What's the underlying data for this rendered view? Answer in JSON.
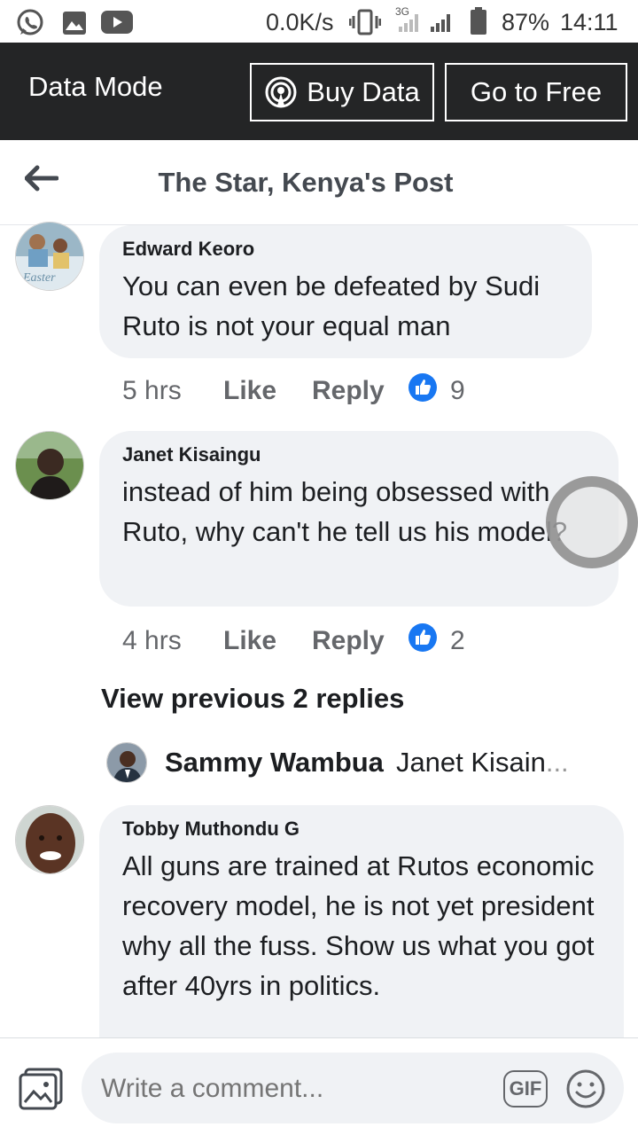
{
  "status_bar": {
    "net_speed": "0.0K/s",
    "network_type": "3G",
    "battery": "87%",
    "time": "14:11",
    "icons": [
      "whatsapp-icon",
      "gallery-icon",
      "youtube-icon",
      "vibrate-icon",
      "signal-icon",
      "battery-icon"
    ]
  },
  "data_mode": {
    "title": "Data Mode",
    "buy_data_label": "Buy Data",
    "go_free_label": "Go to Free"
  },
  "header": {
    "title": "The Star, Kenya's Post"
  },
  "comments": [
    {
      "author": "Edward Keoro",
      "text": "You can even be defeated by Sudi Ruto is not your equal man",
      "time": "5 hrs",
      "like_label": "Like",
      "reply_label": "Reply",
      "reactions": "9"
    },
    {
      "author": "Janet Kisaingu",
      "text": "instead of him being obsessed with Ruto, why can't he tell us his model?",
      "time": "4 hrs",
      "like_label": "Like",
      "reply_label": "Reply",
      "reactions": "2"
    },
    {
      "author": "Tobby Muthondu G",
      "text": "All guns are trained at Rutos economic recovery model, he is not yet president why all the fuss. Show us what you got after 40yrs in politics."
    }
  ],
  "view_previous": "View previous 2 replies",
  "reply_preview": {
    "name": "Sammy Wambua",
    "snippet": "Janet Kisain",
    "ellipsis": "..."
  },
  "composer": {
    "placeholder": "Write a comment...",
    "gif_label": "GIF"
  },
  "colors": {
    "databar_bg": "#242526",
    "bubble_bg": "#f0f2f5",
    "like_blue": "#1877f2",
    "meta_gray": "#65676b"
  }
}
